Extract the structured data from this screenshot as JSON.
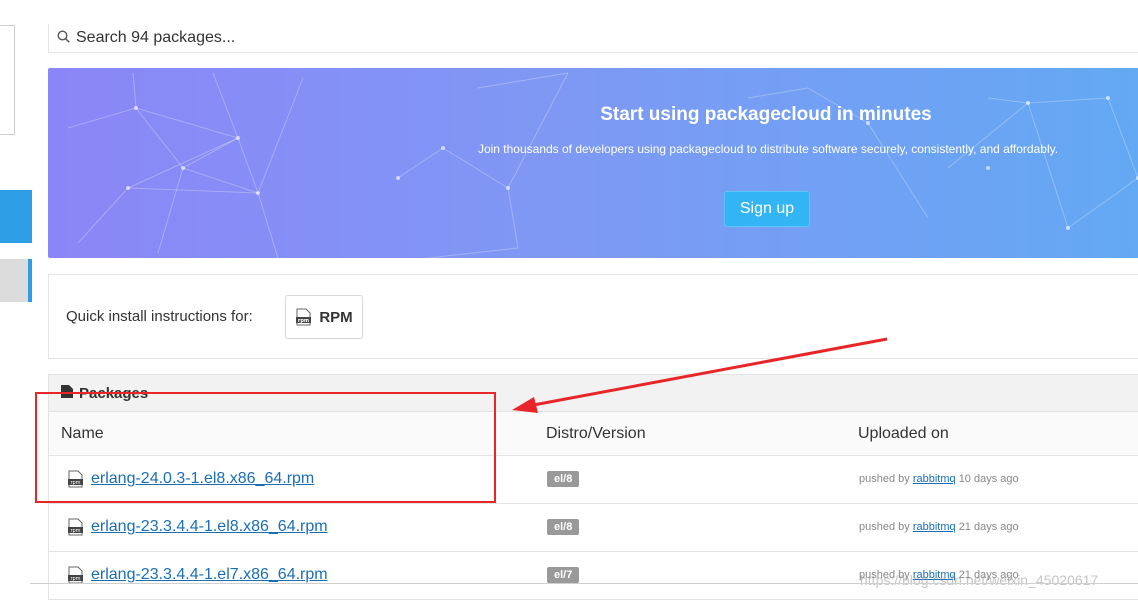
{
  "search": {
    "placeholder": "Search 94 packages..."
  },
  "hero": {
    "title": "Start using packagecloud in minutes",
    "subtitle": "Join thousands of developers using packagecloud to distribute software securely, consistently, and affordably.",
    "cta_label": "Sign up"
  },
  "quick_install": {
    "label": "Quick install instructions for:",
    "rpm_label": "RPM"
  },
  "packages": {
    "title": "Packages",
    "columns": {
      "name": "Name",
      "distro": "Distro/Version",
      "uploaded": "Uploaded on"
    },
    "rows": [
      {
        "name": "erlang-24.0.3-1.el8.x86_64.rpm",
        "distro": "el/8",
        "pushed_prefix": "pushed by",
        "user": "rabbitmq",
        "age": "10 days ago"
      },
      {
        "name": "erlang-23.3.4.4-1.el8.x86_64.rpm",
        "distro": "el/8",
        "pushed_prefix": "pushed by",
        "user": "rabbitmq",
        "age": "21 days ago"
      },
      {
        "name": "erlang-23.3.4.4-1.el7.x86_64.rpm",
        "distro": "el/7",
        "pushed_prefix": "pushed by",
        "user": "rabbitmq",
        "age": "21 days ago"
      }
    ]
  },
  "watermark": "https://blog.csdn.net/weixin_45020617",
  "colors": {
    "accent": "#2d9ee6",
    "hero_start": "#8b86f7",
    "hero_end": "#63a9f3",
    "annotation_red": "#e8262a",
    "link": "#1a6eb8"
  },
  "icons": [
    "search-icon",
    "rpm-file-icon",
    "packages-icon"
  ]
}
